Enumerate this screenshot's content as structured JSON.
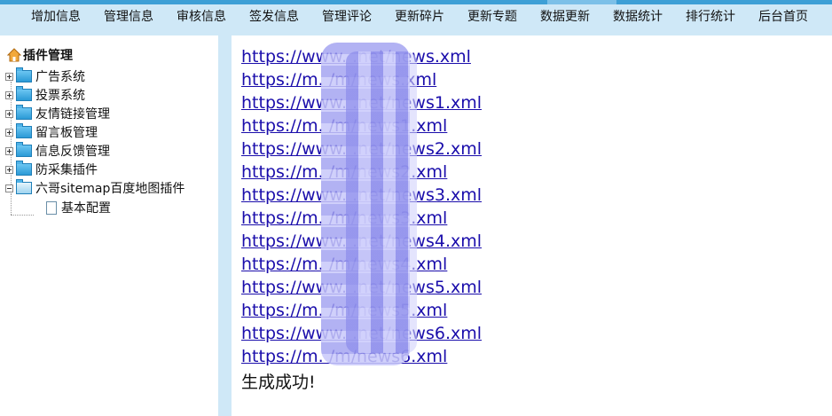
{
  "nav": [
    "增加信息",
    "管理信息",
    "审核信息",
    "签发信息",
    "管理评论",
    "更新碎片",
    "更新专题",
    "数据更新",
    "数据统计",
    "排行统计",
    "后台首页"
  ],
  "tree": {
    "root": "插件管理",
    "items": [
      "广告系统",
      "投票系统",
      "友情链接管理",
      "留言板管理",
      "信息反馈管理",
      "防采集插件",
      "六哥sitemap百度地图插件"
    ],
    "child": "基本配置"
  },
  "links": [
    "https://www.        .net/news.xml",
    "https://m.          /m/news.xml",
    "https://www.        .net/news1.xml",
    "https://m.          /m/news1.xml",
    "https://www.        .net/news2.xml",
    "https://m.          /m/news2.xml",
    "https://www.        .net/news3.xml",
    "https://m.          /m/news3.xml",
    "https://www.        .net/news4.xml",
    "https://m.          /m/news4.xml",
    "https://www.        .net/news5.xml",
    "https://m.          /m/news5.xml",
    "https://www.        .net/news6.xml",
    "https://m.          /m/news6.xml"
  ],
  "result": "生成成功!",
  "colors": {
    "topbar": "#cfe8f7",
    "accent": "#3d9fd6",
    "link": "#1a0dab"
  }
}
